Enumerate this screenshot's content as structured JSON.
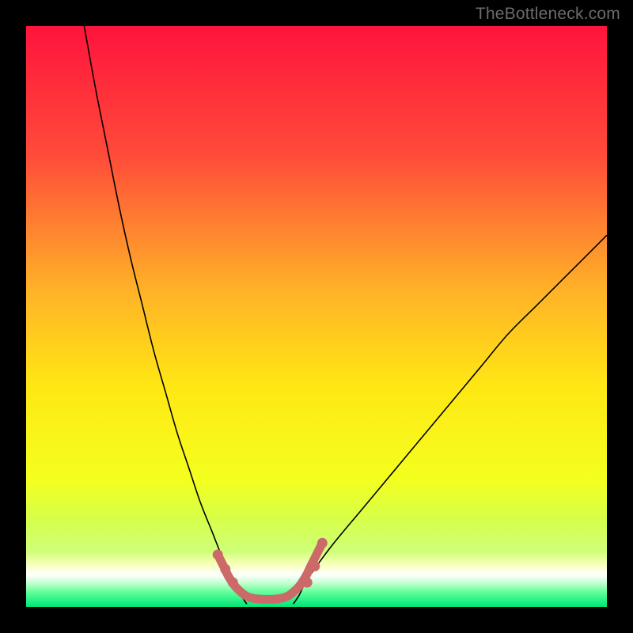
{
  "watermark": "TheBottleneck.com",
  "chart_data": {
    "type": "line",
    "title": "",
    "xlabel": "",
    "ylabel": "",
    "xlim": [
      0,
      100
    ],
    "ylim": [
      0,
      100
    ],
    "grid": false,
    "series": [
      {
        "name": "curve-left",
        "x": [
          10,
          12,
          14,
          16,
          18,
          20,
          22,
          24,
          26,
          28,
          30,
          32,
          34,
          36,
          37,
          38
        ],
        "y": [
          100,
          89,
          79,
          69,
          60,
          52,
          44,
          37,
          30,
          24,
          18,
          13,
          8,
          4,
          2,
          0.5
        ],
        "stroke": "#000000",
        "width": 1.6
      },
      {
        "name": "curve-right",
        "x": [
          46,
          47,
          48,
          50,
          53,
          58,
          63,
          68,
          73,
          78,
          83,
          88,
          93,
          98,
          100
        ],
        "y": [
          0.5,
          2,
          4,
          7,
          11,
          17,
          23,
          29,
          35,
          41,
          47,
          52,
          57,
          62,
          64
        ],
        "stroke": "#000000",
        "width": 1.6
      },
      {
        "name": "bracket",
        "x": [
          33,
          34,
          35,
          36.5,
          39,
          44,
          46.5,
          48,
          49,
          50,
          51
        ],
        "y": [
          9,
          7,
          5,
          3,
          1.5,
          1.5,
          3,
          5,
          7,
          9,
          11
        ],
        "stroke": "#cc6a6a",
        "width": 11,
        "dots_x": [
          33,
          34.3,
          35.6,
          48.4,
          49.7,
          51
        ],
        "dots_y": [
          9,
          6.5,
          4.2,
          4.2,
          7,
          11
        ]
      }
    ],
    "background_gradient": {
      "stops": [
        {
          "offset": 0.0,
          "color": "#ff143c"
        },
        {
          "offset": 0.22,
          "color": "#ff4a3a"
        },
        {
          "offset": 0.45,
          "color": "#ffb028"
        },
        {
          "offset": 0.62,
          "color": "#ffe714"
        },
        {
          "offset": 0.78,
          "color": "#f4ff1e"
        },
        {
          "offset": 0.85,
          "color": "#d6ff4a"
        },
        {
          "offset": 0.905,
          "color": "#cfff7a"
        },
        {
          "offset": 0.925,
          "color": "#f6ffb4"
        },
        {
          "offset": 0.945,
          "color": "#ffffff"
        },
        {
          "offset": 0.958,
          "color": "#c8ffd2"
        },
        {
          "offset": 0.972,
          "color": "#71ffa0"
        },
        {
          "offset": 0.986,
          "color": "#30f58a"
        },
        {
          "offset": 1.0,
          "color": "#00e676"
        }
      ]
    }
  }
}
